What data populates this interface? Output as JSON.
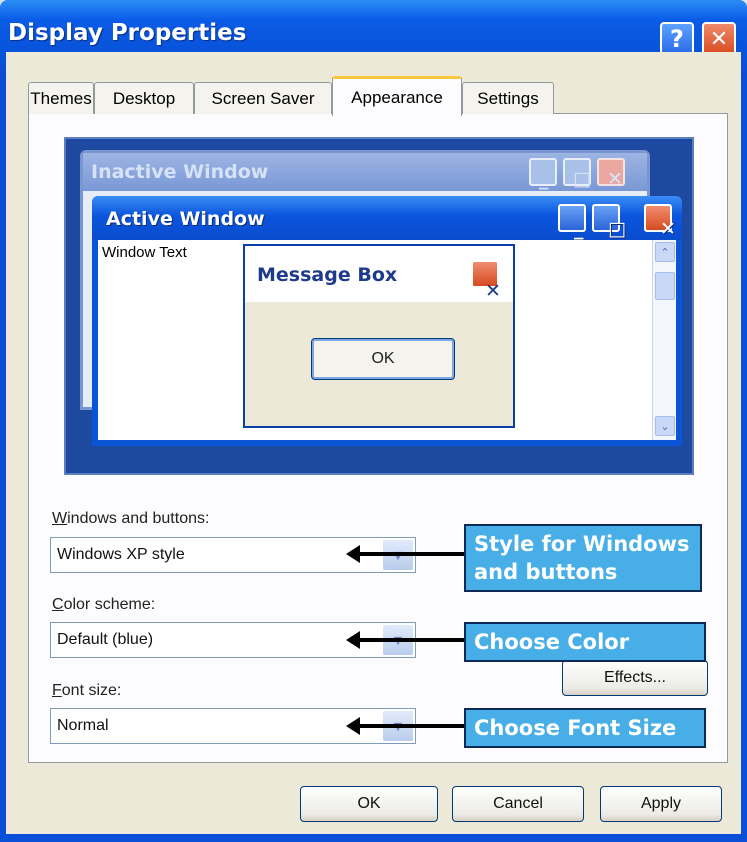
{
  "window": {
    "title": "Display Properties",
    "help_glyph": "?",
    "close_glyph": "✕"
  },
  "tabs": [
    {
      "label": "Themes"
    },
    {
      "label": "Desktop"
    },
    {
      "label": "Screen Saver"
    },
    {
      "label": "Appearance"
    },
    {
      "label": "Settings"
    }
  ],
  "preview": {
    "inactive_title": "Inactive Window",
    "active_title": "Active Window",
    "window_text": "Window Text",
    "message_box_title": "Message Box",
    "message_box_ok": "OK",
    "min_glyph": "_",
    "max_glyph": "□",
    "close_glyph": "✕",
    "scroll_up_glyph": "⌃",
    "scroll_down_glyph": "⌄"
  },
  "fields": {
    "windows_buttons": {
      "label_prefix": "W",
      "label_rest": "indows and buttons:",
      "value": "Windows XP style"
    },
    "color_scheme": {
      "label_prefix": "C",
      "label_rest": "olor scheme:",
      "value": "Default (blue)"
    },
    "font_size": {
      "label_prefix": "F",
      "label_rest": "ont size:",
      "value": "Normal"
    },
    "drop_glyph": "▼"
  },
  "buttons": {
    "effects": "Effects...",
    "ok": "OK",
    "cancel": "Cancel",
    "apply": "Apply"
  },
  "callouts": {
    "windows_buttons": "Style for Windows and buttons",
    "color": "Choose Color",
    "font_size": "Choose Font Size"
  },
  "colors": {
    "titlebar": "#0a5be6",
    "callout": "#48aee8",
    "close": "#d84a1e"
  }
}
